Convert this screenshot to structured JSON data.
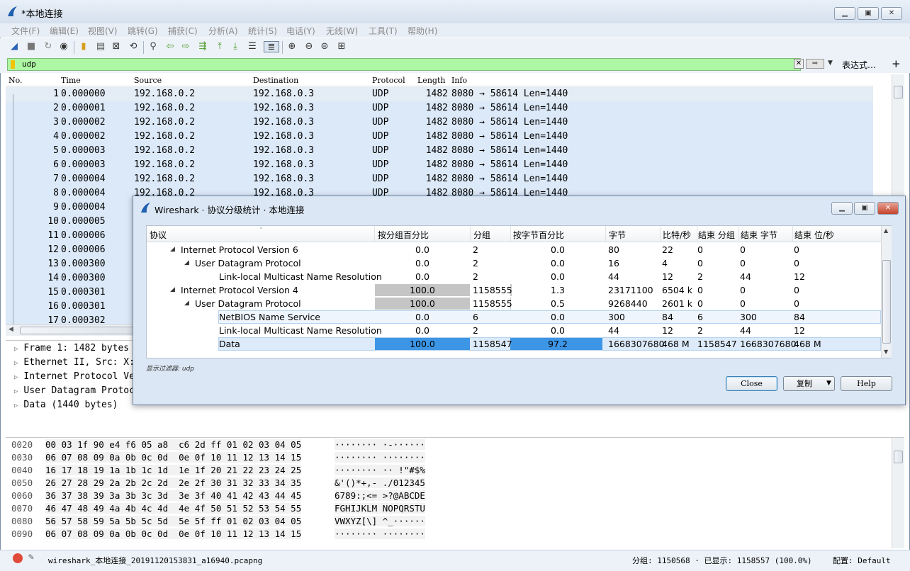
{
  "window": {
    "title": "*本地连接"
  },
  "menu": [
    "文件(F)",
    "编辑(E)",
    "视图(V)",
    "跳转(G)",
    "捕获(C)",
    "分析(A)",
    "统计(S)",
    "电话(Y)",
    "无线(W)",
    "工具(T)",
    "帮助(H)"
  ],
  "filter": {
    "value": "udp",
    "expr_label": "表达式…",
    "plus": "+"
  },
  "packet_list": {
    "columns": [
      "No.",
      "Time",
      "Source",
      "Destination",
      "Protocol",
      "Length",
      "Info"
    ],
    "rows": [
      {
        "no": "1",
        "time": "0.000000",
        "src": "192.168.0.2",
        "dst": "192.168.0.3",
        "proto": "UDP",
        "len": "1482",
        "info": "8080 → 58614 Len=1440"
      },
      {
        "no": "2",
        "time": "0.000001",
        "src": "192.168.0.2",
        "dst": "192.168.0.3",
        "proto": "UDP",
        "len": "1482",
        "info": "8080 → 58614 Len=1440"
      },
      {
        "no": "3",
        "time": "0.000002",
        "src": "192.168.0.2",
        "dst": "192.168.0.3",
        "proto": "UDP",
        "len": "1482",
        "info": "8080 → 58614 Len=1440"
      },
      {
        "no": "4",
        "time": "0.000002",
        "src": "192.168.0.2",
        "dst": "192.168.0.3",
        "proto": "UDP",
        "len": "1482",
        "info": "8080 → 58614 Len=1440"
      },
      {
        "no": "5",
        "time": "0.000003",
        "src": "192.168.0.2",
        "dst": "192.168.0.3",
        "proto": "UDP",
        "len": "1482",
        "info": "8080 → 58614 Len=1440"
      },
      {
        "no": "6",
        "time": "0.000003",
        "src": "192.168.0.2",
        "dst": "192.168.0.3",
        "proto": "UDP",
        "len": "1482",
        "info": "8080 → 58614 Len=1440"
      },
      {
        "no": "7",
        "time": "0.000004",
        "src": "192.168.0.2",
        "dst": "192.168.0.3",
        "proto": "UDP",
        "len": "1482",
        "info": "8080 → 58614 Len=1440"
      },
      {
        "no": "8",
        "time": "0.000004",
        "src": "192.168.0.2",
        "dst": "192.168.0.3",
        "proto": "UDP",
        "len": "1482",
        "info": "8080 → 58614 Len=1440"
      },
      {
        "no": "9",
        "time": "0.000004",
        "src": "",
        "dst": "",
        "proto": "",
        "len": "",
        "info": ""
      },
      {
        "no": "10",
        "time": "0.000005",
        "src": "",
        "dst": "",
        "proto": "",
        "len": "",
        "info": ""
      },
      {
        "no": "11",
        "time": "0.000006",
        "src": "",
        "dst": "",
        "proto": "",
        "len": "",
        "info": ""
      },
      {
        "no": "12",
        "time": "0.000006",
        "src": "",
        "dst": "",
        "proto": "",
        "len": "",
        "info": ""
      },
      {
        "no": "13",
        "time": "0.000300",
        "src": "",
        "dst": "",
        "proto": "",
        "len": "",
        "info": ""
      },
      {
        "no": "14",
        "time": "0.000300",
        "src": "",
        "dst": "",
        "proto": "",
        "len": "",
        "info": ""
      },
      {
        "no": "15",
        "time": "0.000301",
        "src": "",
        "dst": "",
        "proto": "",
        "len": "",
        "info": ""
      },
      {
        "no": "16",
        "time": "0.000301",
        "src": "",
        "dst": "",
        "proto": "",
        "len": "",
        "info": ""
      },
      {
        "no": "17",
        "time": "0.000302",
        "src": "",
        "dst": "",
        "proto": "",
        "len": "",
        "info": ""
      }
    ]
  },
  "details": [
    "Frame 1: 1482 bytes",
    "Ethernet II, Src: X:",
    "Internet Protocol Ve",
    "User Datagram Protoc",
    "Data (1440 bytes)"
  ],
  "hex": [
    {
      "off": "0020",
      "bytes": "00 03 1f 90 e4 f6 05 a8  c6 2d ff 01 02 03 04 05",
      "ascii": "········ ·-······"
    },
    {
      "off": "0030",
      "bytes": "06 07 08 09 0a 0b 0c 0d  0e 0f 10 11 12 13 14 15",
      "ascii": "········ ········"
    },
    {
      "off": "0040",
      "bytes": "16 17 18 19 1a 1b 1c 1d  1e 1f 20 21 22 23 24 25",
      "ascii": "········ ·· !\"#$%"
    },
    {
      "off": "0050",
      "bytes": "26 27 28 29 2a 2b 2c 2d  2e 2f 30 31 32 33 34 35",
      "ascii": "&'()*+,- ./012345"
    },
    {
      "off": "0060",
      "bytes": "36 37 38 39 3a 3b 3c 3d  3e 3f 40 41 42 43 44 45",
      "ascii": "6789:;<= >?@ABCDE"
    },
    {
      "off": "0070",
      "bytes": "46 47 48 49 4a 4b 4c 4d  4e 4f 50 51 52 53 54 55",
      "ascii": "FGHIJKLM NOPQRSTU"
    },
    {
      "off": "0080",
      "bytes": "56 57 58 59 5a 5b 5c 5d  5e 5f ff 01 02 03 04 05",
      "ascii": "VWXYZ[\\] ^_······"
    },
    {
      "off": "0090",
      "bytes": "06 07 08 09 0a 0b 0c 0d  0e 0f 10 11 12 13 14 15",
      "ascii": "········ ········"
    }
  ],
  "status": {
    "file": "wireshark_本地连接_20191120153831_a16940.pcapng",
    "packets": "分组: 1150568 · 已显示: 1158557 (100.0%)",
    "profile": "配置: Default"
  },
  "dialog": {
    "title": "Wireshark · 协议分级统计 · 本地连接",
    "columns": [
      "协议",
      "按分组百分比",
      "分组",
      "按字节百分比",
      "字节",
      "比特/秒",
      "结束 分组",
      "结束 字节",
      "结束 位/秒"
    ],
    "rows": [
      {
        "name": "Internet Protocol Version 6",
        "indent": 1,
        "exp": "◢",
        "pp": "0.0",
        "ppv": 0,
        "pk": "2",
        "bp": "0.0",
        "bpv": 0,
        "bytes": "80",
        "bps": "22",
        "ep": "0",
        "eb": "0",
        "ebps": "0"
      },
      {
        "name": "User Datagram Protocol",
        "indent": 2,
        "exp": "◢",
        "pp": "0.0",
        "ppv": 0,
        "pk": "2",
        "bp": "0.0",
        "bpv": 0,
        "bytes": "16",
        "bps": "4",
        "ep": "0",
        "eb": "0",
        "ebps": "0"
      },
      {
        "name": "Link-local Multicast Name Resolution",
        "indent": 3,
        "exp": "",
        "pp": "0.0",
        "ppv": 0,
        "pk": "2",
        "bp": "0.0",
        "bpv": 0,
        "bytes": "44",
        "bps": "12",
        "ep": "2",
        "eb": "44",
        "ebps": "12"
      },
      {
        "name": "Internet Protocol Version 4",
        "indent": 1,
        "exp": "◢",
        "pp": "100.0",
        "ppv": 100,
        "pk": "1158555",
        "bp": "1.3",
        "bpv": 1.3,
        "bytes": "23171100",
        "bps": "6504 k",
        "ep": "0",
        "eb": "0",
        "ebps": "0"
      },
      {
        "name": "User Datagram Protocol",
        "indent": 2,
        "exp": "◢",
        "pp": "100.0",
        "ppv": 100,
        "pk": "1158555",
        "bp": "0.5",
        "bpv": 0.5,
        "bytes": "9268440",
        "bps": "2601 k",
        "ep": "0",
        "eb": "0",
        "ebps": "0"
      },
      {
        "name": "NetBIOS Name Service",
        "indent": 3,
        "exp": "",
        "pp": "0.0",
        "ppv": 0,
        "pk": "6",
        "bp": "0.0",
        "bpv": 0,
        "bytes": "300",
        "bps": "84",
        "ep": "6",
        "eb": "300",
        "ebps": "84"
      },
      {
        "name": "Link-local Multicast Name Resolution",
        "indent": 3,
        "exp": "",
        "pp": "0.0",
        "ppv": 0,
        "pk": "2",
        "bp": "0.0",
        "bpv": 0,
        "bytes": "44",
        "bps": "12",
        "ep": "2",
        "eb": "44",
        "ebps": "12"
      },
      {
        "name": "Data",
        "indent": 3,
        "exp": "",
        "pp": "100.0",
        "ppv": 100,
        "pk": "1158547",
        "bp": "97.2",
        "bpv": 97.2,
        "bytes": "1668307680",
        "bps": "468 M",
        "ep": "1158547",
        "eb": "1668307680",
        "ebps": "468 M"
      }
    ],
    "display_filter": "显示过滤器: udp",
    "buttons": {
      "close": "Close",
      "copy": "复制",
      "help": "Help"
    }
  }
}
